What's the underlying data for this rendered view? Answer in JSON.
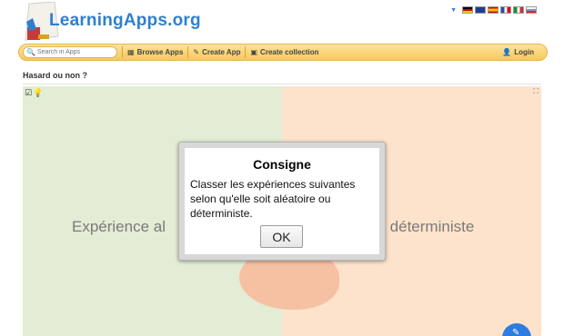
{
  "header": {
    "logo_text": "LearningApps.org",
    "flags": [
      {
        "lang": "de",
        "color": "#c8102e"
      },
      {
        "lang": "en",
        "color": "#1f3c8f"
      },
      {
        "lang": "es",
        "color": "#e9a21b"
      },
      {
        "lang": "fr",
        "color": "#2a4ea3"
      },
      {
        "lang": "it",
        "color": "#1a8a3a"
      },
      {
        "lang": "ru",
        "color": "#d6d6f0"
      }
    ]
  },
  "toolbar": {
    "search_placeholder": "Search in Apps",
    "browse_label": "Browse Apps",
    "create_label": "Create App",
    "collection_label": "Create collection",
    "login_label": "Login"
  },
  "page": {
    "title": "Hasard ou non ?"
  },
  "app": {
    "left_zone_label": "Expérience al",
    "right_zone_label": "ce déterministe",
    "left_color": "#e3ecd4",
    "right_color": "#fde3cc"
  },
  "modal": {
    "title": "Consigne",
    "text": "Classer les expériences suivantes selon qu'elle soit aléatoire ou déterministe.",
    "ok_label": "OK"
  }
}
